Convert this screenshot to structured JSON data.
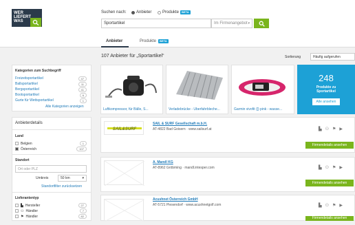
{
  "header": {
    "logo_lines": [
      "WER",
      "LIEFERT",
      "WAS"
    ],
    "search_label": "Suchen nach:",
    "option_suppliers": "Anbieter",
    "option_products": "Produkte",
    "beta": "BETA",
    "search_value": "Sportartikel",
    "region_placeholder": "Im Firmenangebot",
    "search_button": "search"
  },
  "tabs": [
    {
      "label": "Anbieter",
      "active": true
    },
    {
      "label": "Produkte",
      "badge": "BETA",
      "active": false
    }
  ],
  "results_header": {
    "count_title": "107 Anbieter für „Sportartikel“",
    "sort_label": "Sortierung",
    "sort_value": "Häufig aufgerufen"
  },
  "categories": {
    "title": "Kategorien zum Suchbegriff",
    "items": [
      {
        "label": "Freizeitsportartikel",
        "count": "47"
      },
      {
        "label": "Ballsportartikel",
        "count": "11"
      },
      {
        "label": "Bergsportartikel",
        "count": "41"
      },
      {
        "label": "Bootsportartikel",
        "count": "6"
      },
      {
        "label": "Gurte für Wettsportartikel",
        "count": "1"
      }
    ],
    "more": "Alle Kategorien anzeigen"
  },
  "filters": {
    "title": "Anbieterdetails",
    "land_title": "Land",
    "countries": [
      {
        "label": "Belgien",
        "count": "1"
      },
      {
        "label": "Österreich",
        "count": "107",
        "checked": true
      }
    ],
    "location_title": "Standort",
    "location_placeholder": "Ort oder PLZ",
    "radius_label": "Umkreis",
    "radius_value": "50 km",
    "reset_location": "Standortfilter zurücksetzen",
    "supplier_type_title": "Lieferantentyp",
    "types": [
      {
        "label": "Hersteller",
        "count": "27"
      },
      {
        "label": "Händler",
        "count": "7"
      },
      {
        "label": "Händler",
        "count": "82"
      }
    ]
  },
  "products": [
    {
      "caption": "Luftkompressor, für Bälle, S..."
    },
    {
      "caption": "Verladebrücke - Überfahrbleche..."
    },
    {
      "caption": "Garmin vivofit (]) pink - wasse..."
    }
  ],
  "promo": {
    "count": "248",
    "line1": "Produkte zu",
    "line2": "Sportartikel",
    "button": "Alle ansehen"
  },
  "results": [
    {
      "name": "SAIL & SURF Gesellschaft m.b.H.",
      "address": "AT-4822 Bad Goisern · www.sailsurf.at",
      "logo_text": "SAIL&SURF",
      "button": "Firmendetails ansehen"
    },
    {
      "name": "A. Mandl KG",
      "address": "AT-8962 Gröbming · mandl.intesper.com",
      "button": "Firmendetails ansehen"
    },
    {
      "name": "Acushnet Österreich GmbH",
      "address": "AT-5721 Piesendorf · www.acushnetgolf.com",
      "button": "Firmendetails ansehen"
    }
  ],
  "colors": {
    "accent_green": "#7ab51d",
    "brand_navy": "#2b3a4a",
    "beta_blue": "#1da1d6",
    "link_blue": "#1f7ab8"
  }
}
